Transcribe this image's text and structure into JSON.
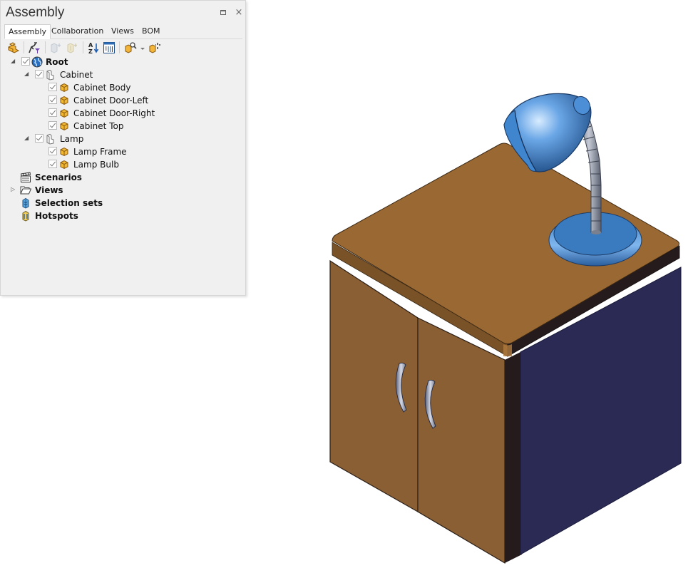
{
  "panel": {
    "title": "Assembly",
    "window_buttons": {
      "restore": "restore-icon",
      "close": "×"
    },
    "tabs": [
      {
        "label": "Assembly",
        "active": true
      },
      {
        "label": "Collaboration",
        "active": false
      },
      {
        "label": "Views",
        "active": false
      },
      {
        "label": "BOM",
        "active": false
      }
    ],
    "toolbar": [
      {
        "name": "assembly-icon",
        "enabled": true
      },
      {
        "name": "filter-icon",
        "enabled": true
      },
      {
        "name": "add-part-icon",
        "enabled": false
      },
      {
        "name": "add-hotspot-icon",
        "enabled": false
      },
      {
        "name": "sort-az-icon",
        "enabled": true
      },
      {
        "name": "properties-grid-icon",
        "enabled": true
      },
      {
        "name": "find-part-icon",
        "enabled": true,
        "dropdown": true
      },
      {
        "name": "select-part-icon",
        "enabled": true
      }
    ],
    "tree": {
      "root": {
        "label": "Root",
        "checked": true,
        "expanded": true
      },
      "groups": [
        {
          "label": "Cabinet",
          "checked": true,
          "expanded": true,
          "children": [
            {
              "label": "Cabinet Body",
              "checked": true
            },
            {
              "label": "Cabinet Door-Left",
              "checked": true
            },
            {
              "label": "Cabinet Door-Right",
              "checked": true
            },
            {
              "label": "Cabinet Top",
              "checked": true
            }
          ]
        },
        {
          "label": "Lamp",
          "checked": true,
          "expanded": true,
          "children": [
            {
              "label": "Lamp Frame",
              "checked": true
            },
            {
              "label": "Lamp Bulb",
              "checked": true
            }
          ]
        }
      ],
      "sections": [
        {
          "label": "Scenarios",
          "icon": "clapperboard-icon",
          "expandable": false
        },
        {
          "label": "Views",
          "icon": "folder-icon",
          "expandable": true
        },
        {
          "label": "Selection sets",
          "icon": "selection-set-icon",
          "expandable": false
        },
        {
          "label": "Hotspots",
          "icon": "hotspot-icon",
          "expandable": false
        }
      ]
    }
  },
  "viewport": {
    "model": "Cabinet with desk lamp",
    "colors": {
      "wood_top": "#9a6832",
      "wood_front": "#8a5f33",
      "wood_edge": "#7a5228",
      "side_dark": "#251b1c",
      "side_blue": "#2a2a55",
      "lamp_blue": "#3a7bbf",
      "lamp_light": "#8fc0f0",
      "metal": "#9aa0b0"
    }
  }
}
